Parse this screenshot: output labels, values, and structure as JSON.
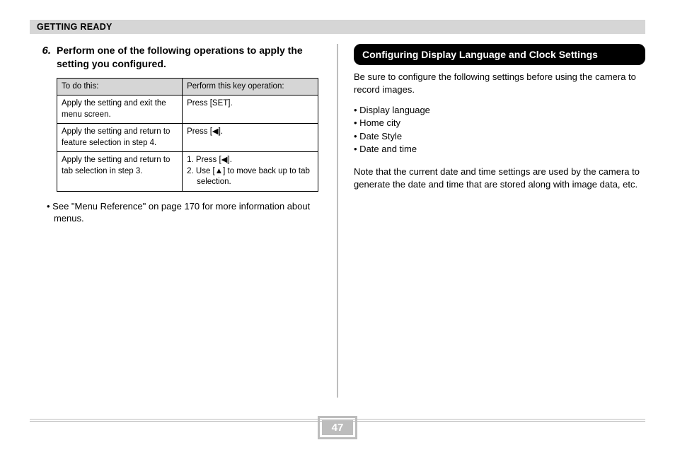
{
  "section_header": "GETTING READY",
  "left": {
    "step_number": "6.",
    "step_text": "Perform one of the following operations to apply the setting you configured.",
    "table": {
      "headers": [
        "To do this:",
        "Perform this key operation:"
      ],
      "rows": [
        {
          "c1": "Apply the setting and exit the menu screen.",
          "c2": "Press [SET]."
        },
        {
          "c1": "Apply the setting and return to feature selection in step 4.",
          "c2": "Press [◀]."
        },
        {
          "c1": "Apply the setting and return to tab selection in step 3.",
          "c2_list": [
            "1. Press [◀].",
            "2. Use [▲] to move back up to tab selection."
          ]
        }
      ]
    },
    "bullet_note": "• See \"Menu Reference\" on page 170 for more information about menus."
  },
  "right": {
    "callout": "Configuring Display Language and Clock Settings",
    "intro": "Be sure to configure the following settings before using the camera to record images.",
    "bullets": [
      "• Display language",
      "• Home city",
      "• Date Style",
      "• Date and time"
    ],
    "note": "Note that the current date and time settings are used by the camera to generate the date and time that are stored along with image data, etc."
  },
  "page_number": "47"
}
